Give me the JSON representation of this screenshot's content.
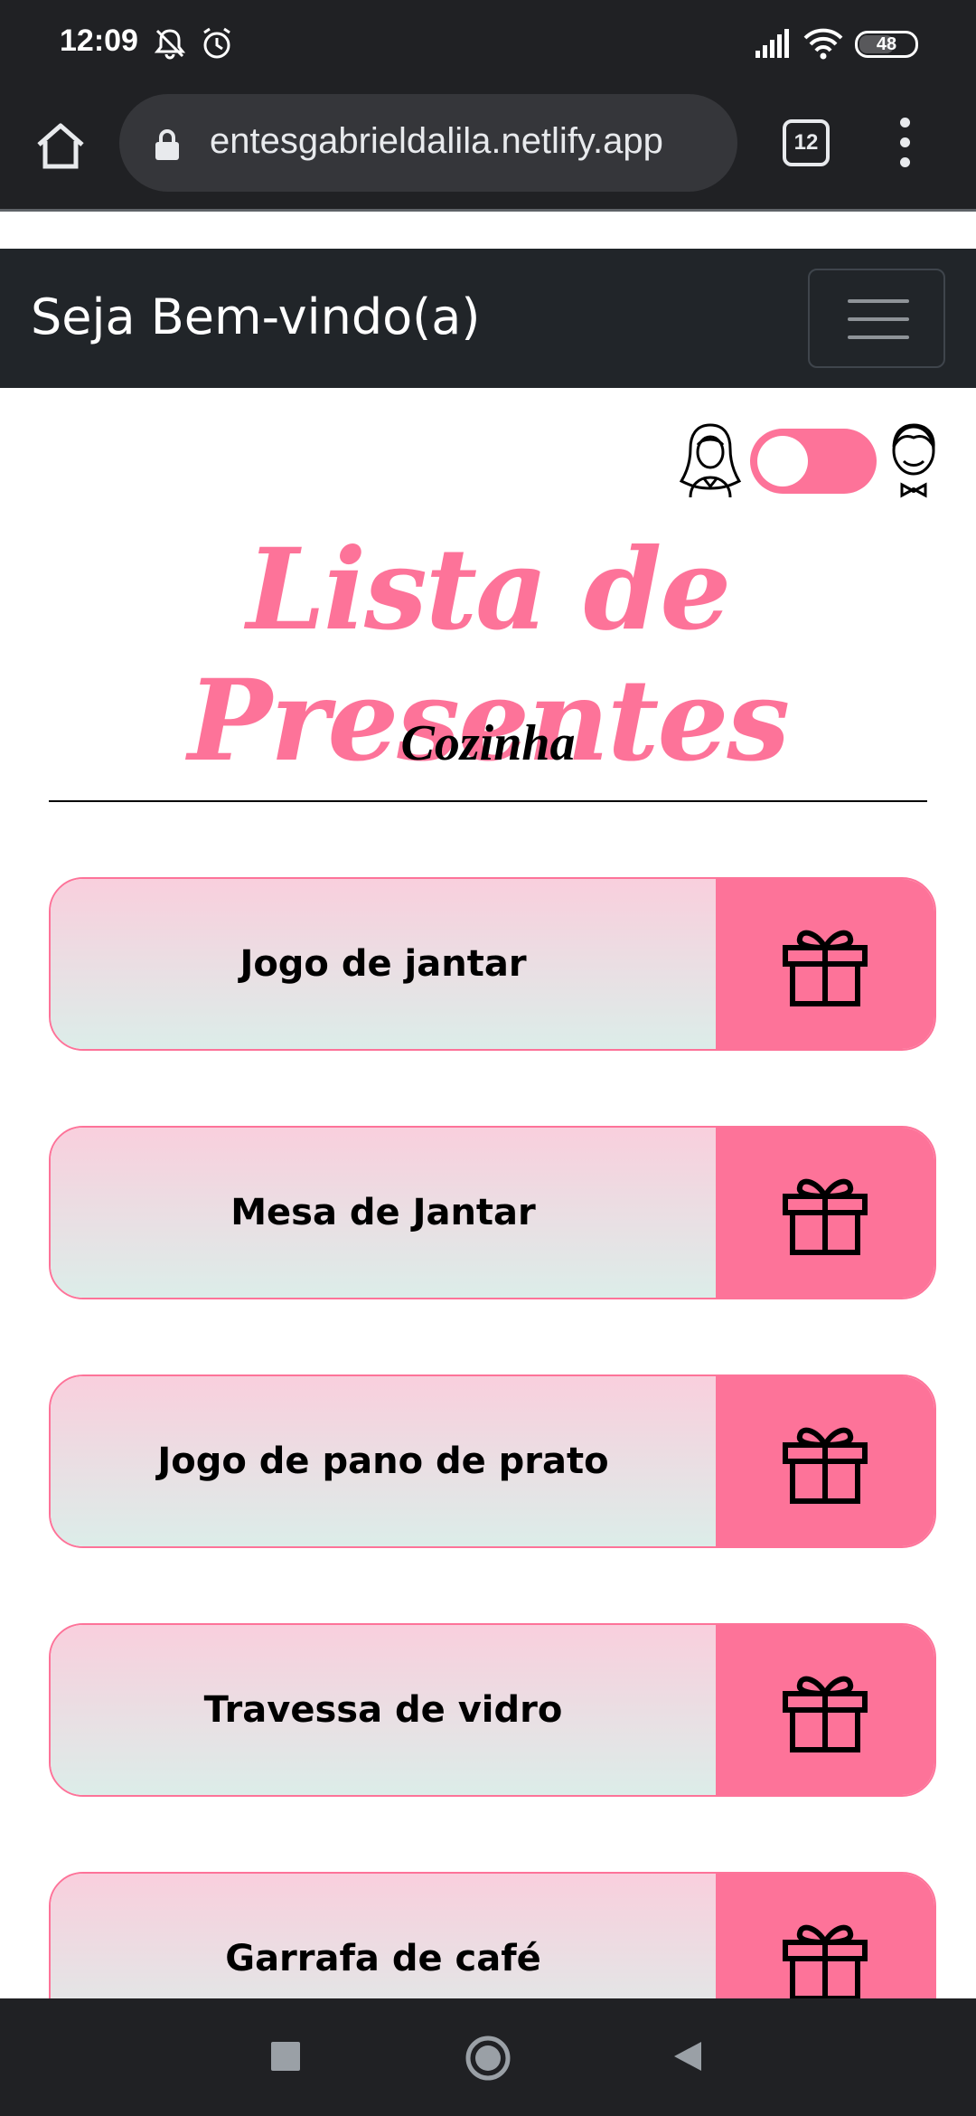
{
  "status_bar": {
    "time": "12:09",
    "battery": "48",
    "icons": [
      "mute-icon",
      "alarm-icon",
      "signal-icon",
      "wifi-icon",
      "battery-icon"
    ]
  },
  "browser": {
    "url": "entesgabrieldalila.netlify.app",
    "tab_count": "12",
    "icons": [
      "home-icon",
      "lock-icon",
      "tabs-icon",
      "more-vert-icon"
    ]
  },
  "navbar": {
    "brand": "Seja Bem-vindo(a)",
    "toggler_icon": "hamburger-menu-icon"
  },
  "toggle": {
    "left_icon": "bride-icon",
    "right_icon": "groom-icon",
    "state": "bride"
  },
  "page": {
    "title": "Lista de Presentes",
    "section": "Cozinha"
  },
  "gifts": [
    {
      "name": "Jogo de jantar",
      "icon": "gift-icon"
    },
    {
      "name": "Mesa de Jantar",
      "icon": "gift-icon"
    },
    {
      "name": "Jogo de pano de prato",
      "icon": "gift-icon"
    },
    {
      "name": "Travessa de vidro",
      "icon": "gift-icon"
    },
    {
      "name": "Garrafa de café",
      "icon": "gift-icon"
    }
  ],
  "colors": {
    "accent": "#fd7399",
    "navbar": "#212529",
    "chrome": "#202124"
  },
  "system_nav": [
    "recents-icon",
    "home-circle-icon",
    "back-icon"
  ]
}
